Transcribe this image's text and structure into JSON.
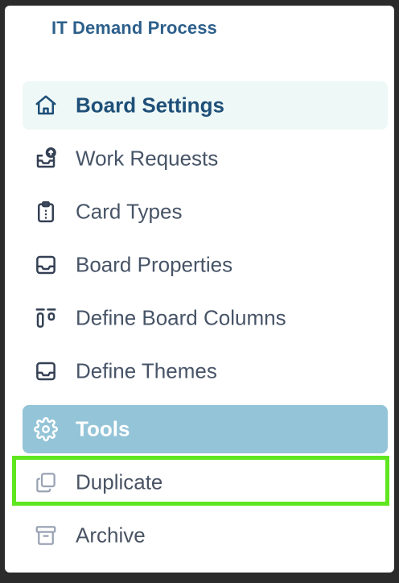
{
  "board": {
    "title": "IT Demand Process"
  },
  "menu": {
    "items": [
      {
        "label": "Board Settings",
        "icon": "home-icon",
        "state": "active"
      },
      {
        "label": "Work Requests",
        "icon": "inbox-upload-icon",
        "state": "normal"
      },
      {
        "label": "Card Types",
        "icon": "clipboard-list-icon",
        "state": "normal"
      },
      {
        "label": "Board Properties",
        "icon": "inbox-tray-icon",
        "state": "normal"
      },
      {
        "label": "Define Board Columns",
        "icon": "columns-icon",
        "state": "normal"
      },
      {
        "label": "Define Themes",
        "icon": "inbox-tray-icon",
        "state": "normal"
      },
      {
        "label": "Tools",
        "icon": "gear-icon",
        "state": "hover"
      },
      {
        "label": "Duplicate",
        "icon": "copy-icon",
        "state": "highlighted"
      },
      {
        "label": "Archive",
        "icon": "archive-box-icon",
        "state": "normal"
      }
    ]
  },
  "colors": {
    "accent_title": "#2d5f8b",
    "active_bg": "#eef8f7",
    "tools_bg": "#94c4d7",
    "highlight_border": "#5fe61f",
    "text": "#475467"
  }
}
